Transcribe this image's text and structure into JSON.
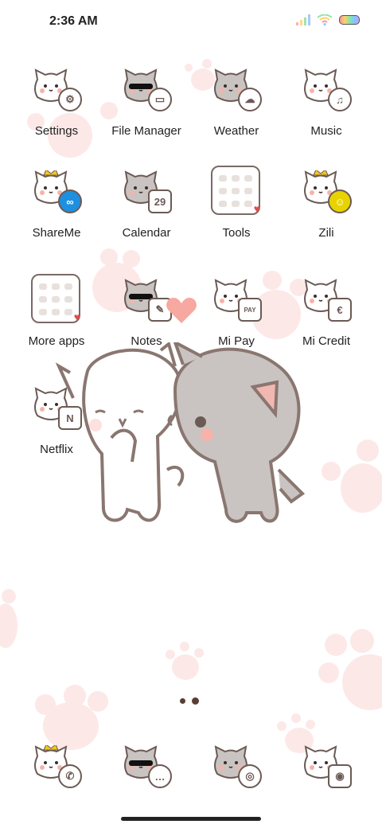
{
  "status_bar": {
    "time": "2:36 AM"
  },
  "apps": [
    {
      "label": "Settings",
      "icon": "gear-icon"
    },
    {
      "label": "File Manager",
      "icon": "folder-icon"
    },
    {
      "label": "Weather",
      "icon": "cloud-icon"
    },
    {
      "label": "Music",
      "icon": "music-note-icon"
    },
    {
      "label": "ShareMe",
      "icon": "share-icon"
    },
    {
      "label": "Calendar",
      "icon": "calendar-icon",
      "badge": "29"
    },
    {
      "label": "Tools",
      "icon": "folder-grid-icon"
    },
    {
      "label": "Zili",
      "icon": "smiley-icon"
    },
    {
      "label": "More apps",
      "icon": "folder-grid-icon"
    },
    {
      "label": "Notes",
      "icon": "pencil-icon"
    },
    {
      "label": "Mi Pay",
      "icon": "pay-icon",
      "badge": "PAY"
    },
    {
      "label": "Mi Credit",
      "icon": "wallet-icon"
    },
    {
      "label": "Netflix",
      "icon": "netflix-icon",
      "badge": "N"
    }
  ],
  "dock": [
    {
      "icon": "phone-icon"
    },
    {
      "icon": "messages-icon"
    },
    {
      "icon": "browser-icon"
    },
    {
      "icon": "camera-icon"
    }
  ],
  "page_indicator": {
    "pages": 2,
    "current": 2
  },
  "colors": {
    "paw": "#fde8e8",
    "outline": "#7a6a66",
    "accent_heart": "#f7a8a0"
  }
}
